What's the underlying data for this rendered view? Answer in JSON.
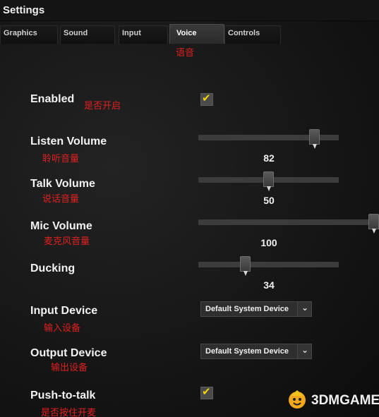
{
  "window": {
    "title": "Settings"
  },
  "tabs": [
    {
      "label": "Graphics"
    },
    {
      "label": "Sound"
    },
    {
      "label": "Input"
    },
    {
      "label": "Voice",
      "annotation": "语音"
    },
    {
      "label": "Controls"
    }
  ],
  "settings": {
    "enabled": {
      "label": "Enabled",
      "annotation": "是否开启",
      "checked": true
    },
    "listen_volume": {
      "label": "Listen Volume",
      "annotation": "聆听音量",
      "value": "82"
    },
    "talk_volume": {
      "label": "Talk Volume",
      "annotation": "说话音量",
      "value": "50"
    },
    "mic_volume": {
      "label": "Mic Volume",
      "annotation": "麦克风音量",
      "value": "100"
    },
    "ducking": {
      "label": "Ducking",
      "value": "34"
    },
    "input_device": {
      "label": "Input Device",
      "annotation": "输入设备",
      "selected": "Default System Device"
    },
    "output_device": {
      "label": "Output Device",
      "annotation": "输出设备",
      "selected": "Default System Device"
    },
    "push_to_talk": {
      "label": "Push-to-talk",
      "annotation": "是否按住开麦",
      "checked": true
    }
  },
  "icons": {
    "checkmark": "check-icon",
    "dropdown_arrow": "chevron-down-icon"
  },
  "colors": {
    "annotation": "#e02020",
    "checkmark": "#f5d214"
  },
  "watermark": {
    "text": "3DMGAME"
  }
}
